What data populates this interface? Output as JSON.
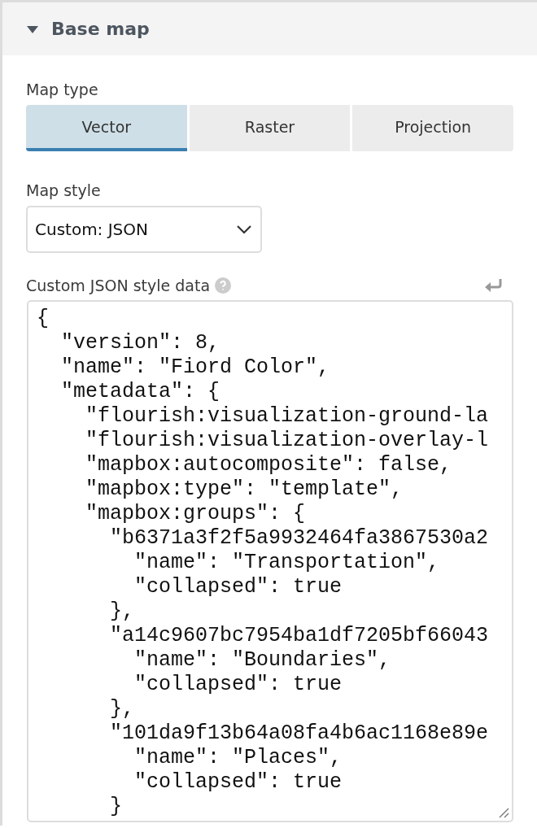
{
  "section": {
    "title": "Base map",
    "expanded": true
  },
  "map_type": {
    "label": "Map type",
    "tabs": [
      {
        "label": "Vector",
        "selected": true
      },
      {
        "label": "Raster",
        "selected": false
      },
      {
        "label": "Projection",
        "selected": false
      }
    ]
  },
  "map_style": {
    "label": "Map style",
    "value": "Custom: JSON"
  },
  "custom_json": {
    "label": "Custom JSON style data",
    "lines": [
      "{",
      "  \"version\": 8,",
      "  \"name\": \"Fiord Color\",",
      "  \"metadata\": {",
      "    \"flourish:visualization-ground-la",
      "    \"flourish:visualization-overlay-l",
      "    \"mapbox:autocomposite\": false,",
      "    \"mapbox:type\": \"template\",",
      "    \"mapbox:groups\": {",
      "      \"b6371a3f2f5a9932464fa3867530a2",
      "        \"name\": \"Transportation\",",
      "        \"collapsed\": true",
      "      },",
      "      \"a14c9607bc7954ba1df7205bf66043",
      "        \"name\": \"Boundaries\",",
      "        \"collapsed\": true",
      "      },",
      "      \"101da9f13b64a08fa4b6ac1168e89e",
      "        \"name\": \"Places\",",
      "        \"collapsed\": true",
      "      }"
    ]
  }
}
